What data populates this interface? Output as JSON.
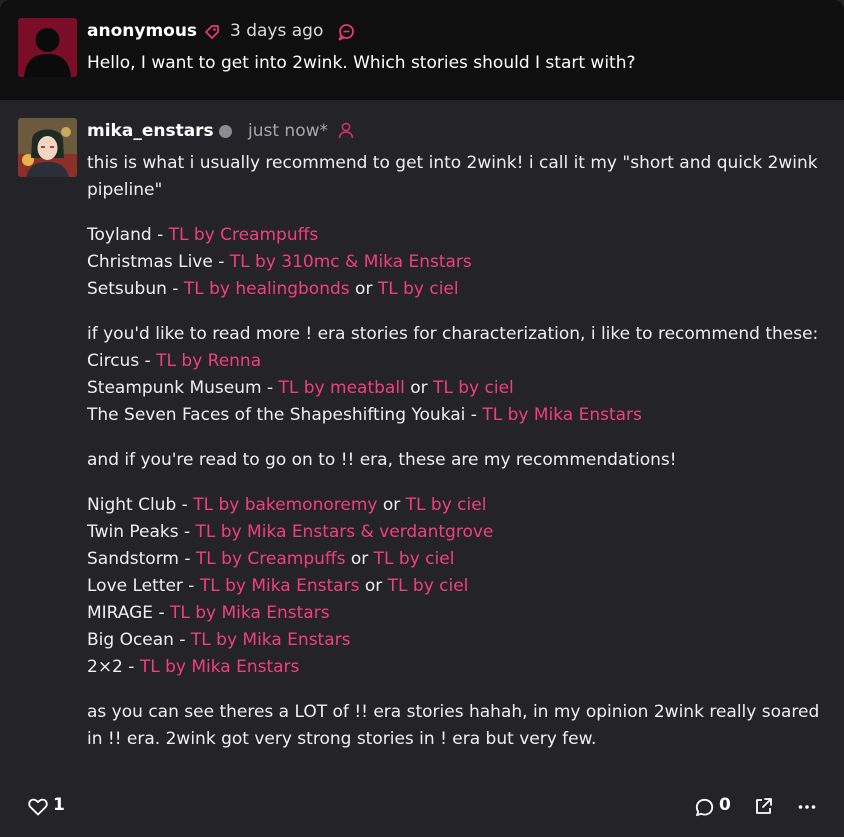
{
  "question": {
    "author": "anonymous",
    "time": "3 days ago",
    "text": "Hello, I want to get into 2wink. Which stories should I start with?",
    "icons": [
      "tag-icon",
      "chat-bubble-icon"
    ]
  },
  "answer": {
    "author": "mika_enstars",
    "time": "just now*",
    "status_icon": "status-dot-icon",
    "follow_icon": "person-icon",
    "intro": "this is what i usually recommend to get into 2wink! i call it my \"short and quick 2wink pipeline\"",
    "group1": [
      {
        "title": "Toyland - ",
        "links": [
          "TL by Creampuffs"
        ]
      },
      {
        "title": "Christmas Live - ",
        "links": [
          "TL by 310mc & Mika Enstars"
        ]
      },
      {
        "title": "Setsubun - ",
        "links": [
          "TL by healingbonds",
          "TL by ciel"
        ]
      }
    ],
    "para2_intro": "if you'd like to read more ! era stories for characterization, i like to recommend these:",
    "group2": [
      {
        "title": "Circus - ",
        "links": [
          "TL by Renna"
        ]
      },
      {
        "title": "Steampunk Museum - ",
        "links": [
          "TL by meatball",
          "TL by ciel"
        ]
      },
      {
        "title": "The Seven Faces of the Shapeshifting Youkai - ",
        "links": [
          "TL by Mika Enstars"
        ]
      }
    ],
    "para3": "and if you're read to go on to !! era, these are my recommendations!",
    "group3": [
      {
        "title": "Night Club - ",
        "links": [
          "TL by bakemonoremy",
          "TL by ciel"
        ]
      },
      {
        "title": "Twin Peaks - ",
        "links": [
          "TL by Mika Enstars & verdantgrove"
        ]
      },
      {
        "title": "Sandstorm - ",
        "links": [
          "TL by Creampuffs",
          "TL by ciel"
        ]
      },
      {
        "title": "Love Letter - ",
        "links": [
          "TL by Mika Enstars",
          "TL by ciel"
        ]
      },
      {
        "title": "MIRAGE - ",
        "links": [
          "TL by Mika Enstars"
        ]
      },
      {
        "title": "Big Ocean - ",
        "links": [
          "TL by Mika Enstars"
        ]
      },
      {
        "title": "2×2 - ",
        "links": [
          "TL by Mika Enstars"
        ]
      }
    ],
    "conjunction": " or ",
    "outro": "as you can see theres a LOT of !! era stories hahah, in my opinion 2wink really soared in !! era. 2wink got very strong stories in ! era but very few."
  },
  "actions": {
    "like_count": "1",
    "comment_count": "0",
    "icons": [
      "heart-icon",
      "comment-icon",
      "share-icon",
      "more-icon"
    ]
  },
  "colors": {
    "link": "#f0407c",
    "question_bg": "#0f0f10",
    "answer_bg": "#242327",
    "avatar_placeholder": "#7a0e28"
  }
}
